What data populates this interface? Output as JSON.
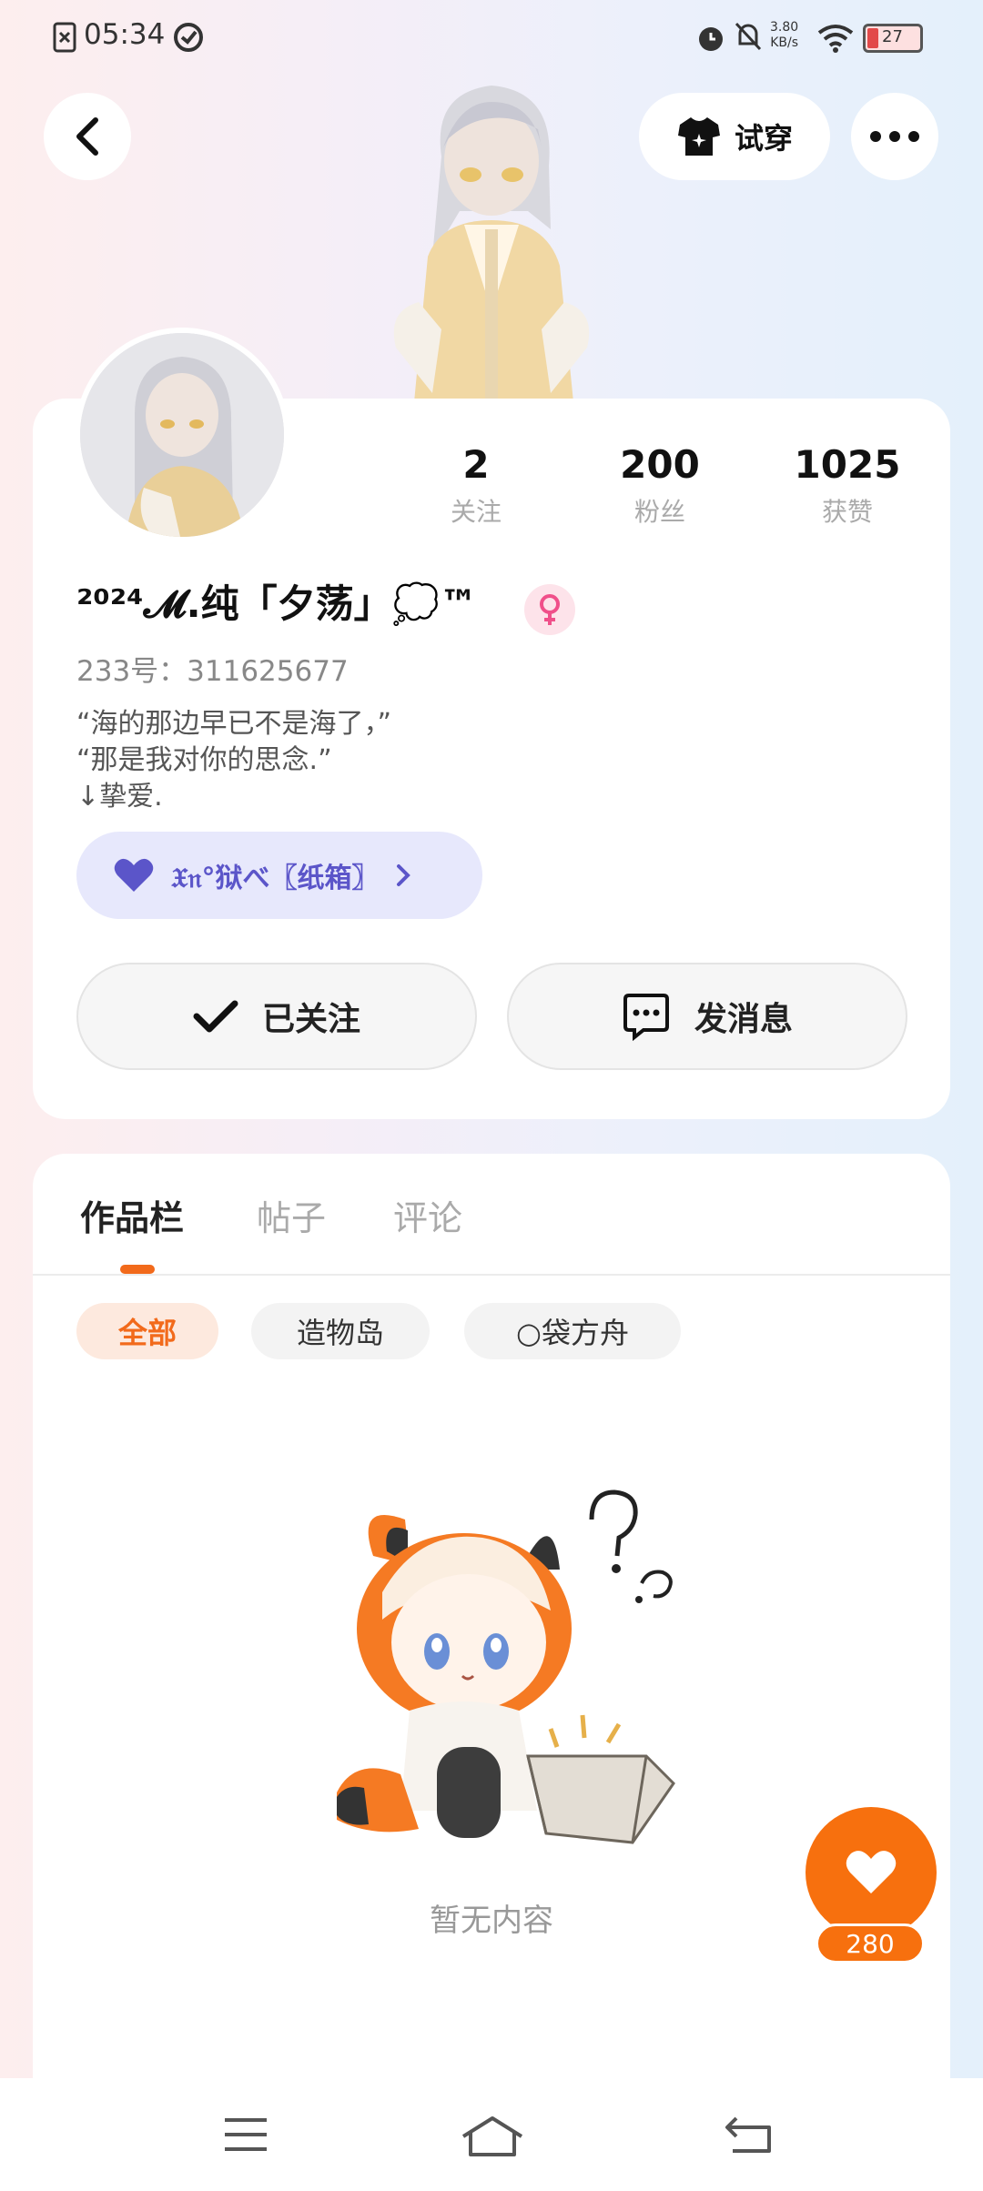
{
  "status_bar": {
    "time": "05:34",
    "net_speed_value": "3.80",
    "net_speed_unit": "KB/s",
    "battery_level": "27"
  },
  "header": {
    "try_on_label": "试穿"
  },
  "profile": {
    "stats": [
      {
        "value": "2",
        "label": "关注"
      },
      {
        "value": "200",
        "label": "粉丝"
      },
      {
        "value": "1025",
        "label": "获赞"
      }
    ],
    "nickname": "²⁰²⁴𝓜.纯「夕荡」💭™",
    "uid": "233号：311625677",
    "bio": [
      "“海的那边早已不是海了，”",
      "“那是我对你的思念.”",
      "↓挚爱."
    ],
    "group_label": "𝔛𝔫°狱べ〖纸箱〗",
    "follow_label": "已关注",
    "message_label": "发消息"
  },
  "tabs": [
    {
      "label": "作品栏",
      "active": true
    },
    {
      "label": "帖子",
      "active": false
    },
    {
      "label": "评论",
      "active": false
    }
  ],
  "filters": [
    {
      "label": "全部",
      "active": true
    },
    {
      "label": "造物岛",
      "active": false
    },
    {
      "label": "○袋方舟",
      "active": false
    }
  ],
  "empty_text": "暂无内容",
  "like": {
    "count": "280"
  },
  "colors": {
    "accent": "#f7700e",
    "group_text": "#5b55c9",
    "group_bg": "#e7e8fc"
  }
}
